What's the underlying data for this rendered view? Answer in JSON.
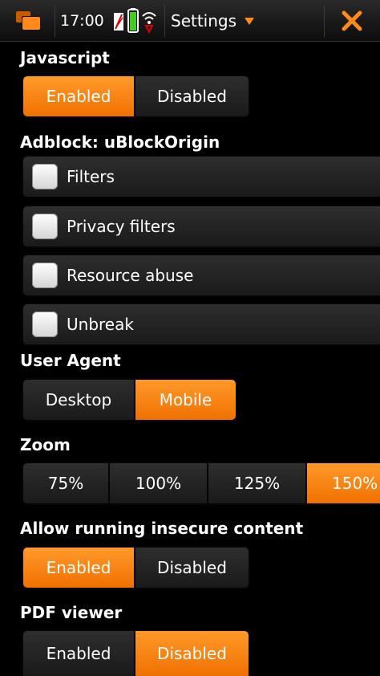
{
  "statusbar": {
    "time": "17:00",
    "menu_title": "Settings"
  },
  "colors": {
    "accent": "#ff8a1a",
    "close": "#ff8a1a",
    "background": "#000000",
    "button": "#242424"
  },
  "icons": [
    "task-switcher-icon",
    "signal-battery-icon",
    "wifi-icon",
    "dropdown-caret-icon",
    "close-icon"
  ],
  "javascript": {
    "label": "Javascript",
    "options": [
      "Enabled",
      "Disabled"
    ],
    "selected": "Enabled"
  },
  "adblock": {
    "label": "Adblock: uBlockOrigin",
    "items": [
      {
        "label": "Filters",
        "checked": false
      },
      {
        "label": "Privacy filters",
        "checked": false
      },
      {
        "label": "Resource abuse",
        "checked": false
      },
      {
        "label": "Unbreak",
        "checked": false
      }
    ]
  },
  "user_agent": {
    "label": "User Agent",
    "options": [
      "Desktop",
      "Mobile"
    ],
    "selected": "Mobile"
  },
  "zoom": {
    "label": "Zoom",
    "options": [
      "75%",
      "100%",
      "125%",
      "150%"
    ],
    "selected": "150%"
  },
  "insecure": {
    "label": "Allow running insecure content",
    "options": [
      "Enabled",
      "Disabled"
    ],
    "selected": "Enabled"
  },
  "pdf": {
    "label": "PDF viewer",
    "options": [
      "Enabled",
      "Disabled"
    ],
    "selected": "Disabled"
  }
}
